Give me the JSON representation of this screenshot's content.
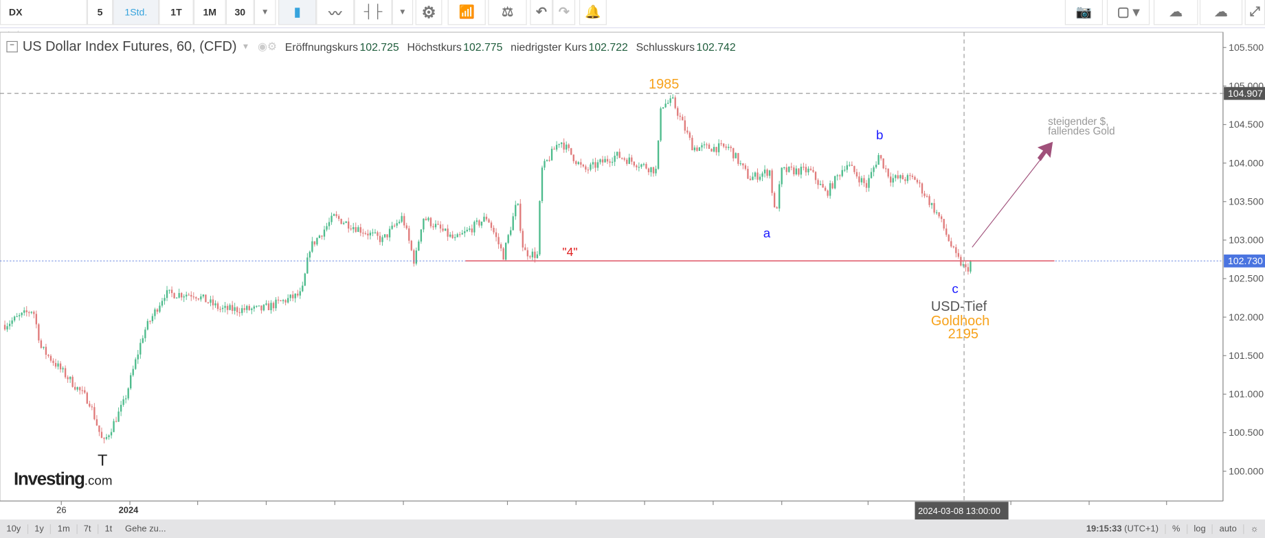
{
  "toolbar": {
    "symbol": "DX",
    "intervals": [
      "5",
      "1Std.",
      "1T",
      "1M",
      "30"
    ],
    "active_interval": "1Std."
  },
  "legend": {
    "title": "US Dollar Index Futures, 60, (CFD)",
    "open_label": "Eröffnungskurs",
    "open": "102.725",
    "high_label": "Höchstkurs",
    "high": "102.775",
    "low_label": "niedrigster Kurs",
    "low": "102.722",
    "close_label": "Schlusskurs",
    "close": "102.742"
  },
  "annotations": {
    "top": "1985",
    "a": "a",
    "b": "b",
    "c": "c",
    "t": "T",
    "four": "\"4\"",
    "usd_low": "USD-Tief",
    "gold_high": "Goldhoch",
    "gold_value": "2195",
    "note1": "steigender $,",
    "note2": "fallendes Gold"
  },
  "logo": {
    "main": "Investing",
    "suffix": ".com"
  },
  "time_axis": {
    "labels": [
      "26",
      "2024"
    ],
    "crosshair": "2024-03-08 13:00:00"
  },
  "bottom": {
    "ranges": [
      "10y",
      "1y",
      "1m",
      "7t",
      "1t"
    ],
    "goto": "Gehe zu...",
    "clock": "19:15:33",
    "tz": "(UTC+1)",
    "percent": "%",
    "log": "log",
    "auto": "auto"
  },
  "colors": {
    "up": "#4dbb8c",
    "down": "#e07b7b",
    "accent": "#36a3dd",
    "orange": "#f7a21b",
    "blue": "#1a1aff",
    "red": "#e02020",
    "arrow": "#a0507a"
  },
  "chart_data": {
    "type": "candlestick",
    "ylim": [
      99.6,
      105.7
    ],
    "yticks": [
      "105.500",
      "105.000",
      "104.500",
      "104.000",
      "103.500",
      "103.000",
      "102.500",
      "102.000",
      "101.500",
      "101.000",
      "100.500",
      "100.000"
    ],
    "last_price": "102.730",
    "crosshair_price": "104.907",
    "support_level": 102.73,
    "path": [
      [
        0,
        101.9
      ],
      [
        35,
        102.1
      ],
      [
        45,
        101.6
      ],
      [
        105,
        100.9
      ],
      [
        122,
        100.35
      ],
      [
        148,
        100.9
      ],
      [
        172,
        101.8
      ],
      [
        198,
        102.3
      ],
      [
        235,
        102.3
      ],
      [
        268,
        102.1
      ],
      [
        318,
        102.1
      ],
      [
        368,
        102.3
      ],
      [
        378,
        102.9
      ],
      [
        408,
        103.3
      ],
      [
        468,
        103.0
      ],
      [
        493,
        103.3
      ],
      [
        508,
        102.7
      ],
      [
        518,
        103.3
      ],
      [
        558,
        103.0
      ],
      [
        598,
        103.3
      ],
      [
        618,
        102.8
      ],
      [
        635,
        103.5
      ],
      [
        643,
        102.85
      ],
      [
        660,
        102.8
      ],
      [
        665,
        103.9
      ],
      [
        688,
        104.3
      ],
      [
        718,
        103.9
      ],
      [
        758,
        104.1
      ],
      [
        808,
        103.9
      ],
      [
        813,
        104.75
      ],
      [
        828,
        104.8
      ],
      [
        853,
        104.2
      ],
      [
        898,
        104.2
      ],
      [
        923,
        103.8
      ],
      [
        948,
        103.9
      ],
      [
        955,
        103.3
      ],
      [
        963,
        103.9
      ],
      [
        998,
        103.9
      ],
      [
        1018,
        103.6
      ],
      [
        1043,
        104.0
      ],
      [
        1068,
        103.7
      ],
      [
        1083,
        104.1
      ],
      [
        1098,
        103.8
      ],
      [
        1128,
        103.8
      ],
      [
        1158,
        103.3
      ],
      [
        1178,
        102.8
      ],
      [
        1192,
        102.6
      ],
      [
        1198,
        102.73
      ]
    ]
  }
}
